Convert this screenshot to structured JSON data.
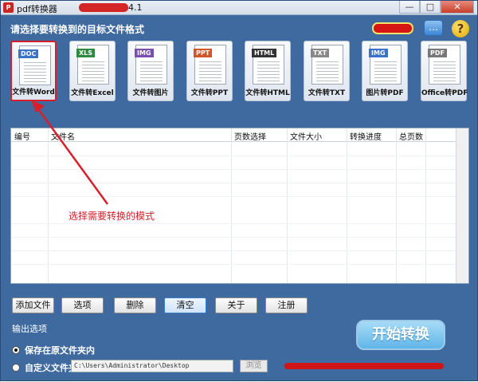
{
  "window": {
    "title_prefix": "pdf转换器",
    "title_version": "4.1",
    "minimize": "—",
    "maximize": "□",
    "close": "✕"
  },
  "header": {
    "prompt": "请选择要转换到的目标文件格式"
  },
  "modes": [
    {
      "tag": "DOC",
      "label": "文件转Word",
      "color": "#3b73c8",
      "selected": true
    },
    {
      "tag": "XLS",
      "label": "文件转Excel",
      "color": "#2e8a3e"
    },
    {
      "tag": "IMG",
      "label": "文件转图片",
      "color": "#7a4fb0"
    },
    {
      "tag": "PPT",
      "label": "文件转PPT",
      "color": "#d0562a"
    },
    {
      "tag": "HTML",
      "label": "文件转HTML",
      "color": "#333333"
    },
    {
      "tag": "TXT",
      "label": "文件转TXT",
      "color": "#888888"
    },
    {
      "tag": "IMG",
      "label": "图片转PDF",
      "color": "#3b73c8"
    },
    {
      "tag": "PDF",
      "label": "Office转PDF",
      "color": "#777777"
    }
  ],
  "table": {
    "columns": [
      "编号",
      "文件名",
      "页数选择",
      "文件大小",
      "转换进度",
      "总页数"
    ]
  },
  "annotation": "选择需要转换的模式",
  "buttons": {
    "add": "添加文件",
    "options": "选项",
    "delete": "删除",
    "clear": "清空",
    "about": "关于",
    "register": "注册"
  },
  "output": {
    "title": "输出选项",
    "save_original": "保存在原文件夹内",
    "custom_folder": "自定义文件夹",
    "path": "C:\\Users\\Administrator\\Desktop",
    "browse": "浏览"
  },
  "start": "开始转换"
}
